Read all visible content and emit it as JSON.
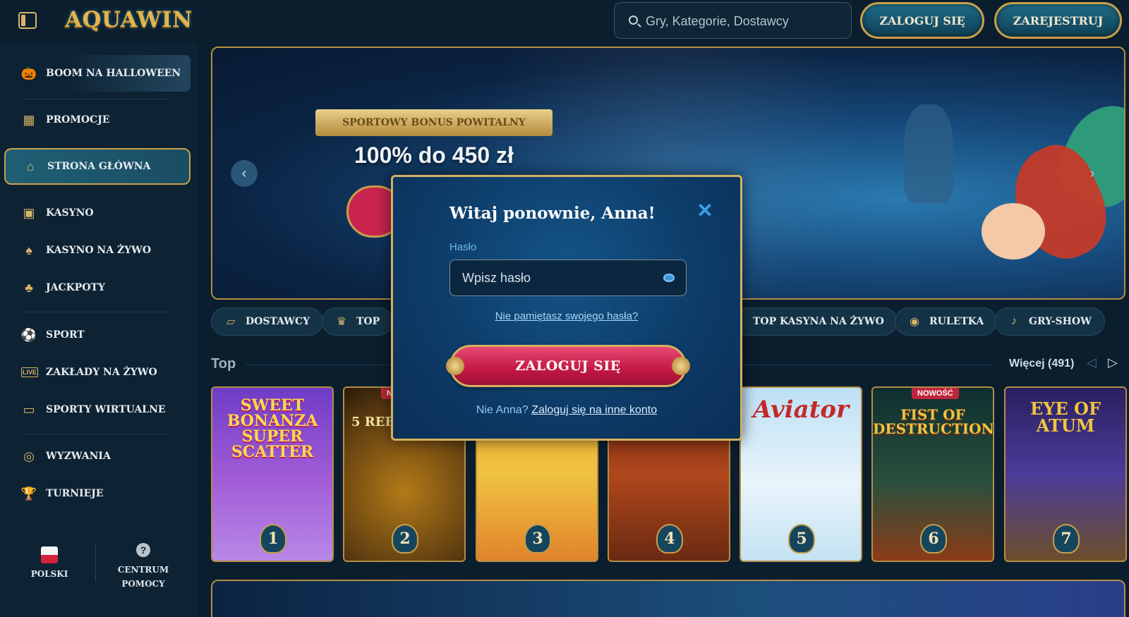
{
  "header": {
    "logo": "AQUAWIN",
    "search_placeholder": "Gry, Kategorie, Dostawcy",
    "login_label": "ZALOGUJ SIĘ",
    "register_label": "ZAREJESTRUJ"
  },
  "sidebar": {
    "items": [
      {
        "label": "BOOM NA HALLOWEEN",
        "icon": "pumpkin-icon"
      },
      {
        "label": "PROMOCJE",
        "icon": "gift-icon"
      },
      {
        "label": "STRONA GŁÓWNA",
        "icon": "home-icon"
      },
      {
        "label": "KASYNO",
        "icon": "slot-machine-icon"
      },
      {
        "label": "KASYNO NA ŻYWO",
        "icon": "live-card-icon"
      },
      {
        "label": "JACKPOTY",
        "icon": "clover-icon"
      },
      {
        "label": "SPORT",
        "icon": "ball-icon"
      },
      {
        "label": "ZAKŁADY NA ŻYWO",
        "icon": "live-badge-icon"
      },
      {
        "label": "SPORTY WIRTUALNE",
        "icon": "virtual-sport-icon"
      },
      {
        "label": "WYZWANIA",
        "icon": "target-icon"
      },
      {
        "label": "TURNIEJE",
        "icon": "trophy-icon"
      }
    ],
    "language": "POLSKI",
    "help": "CENTRUM POMOCY"
  },
  "banner": {
    "ribbon": "SPORTOWY BONUS POWITALNY",
    "headline": "100% do 450 zł"
  },
  "categories": [
    {
      "label": "DOSTAWCY",
      "icon": "scroll-icon"
    },
    {
      "label": "TOP",
      "icon": "crown-icon"
    },
    {
      "label": "TOP KASYNA NA ŻYWO",
      "icon": "live-chip-icon"
    },
    {
      "label": "RULETKA",
      "icon": "roulette-icon"
    },
    {
      "label": "GRY-SHOW",
      "icon": "mic-icon"
    }
  ],
  "top_section": {
    "title": "Top",
    "more": "Więcej (491)",
    "games": [
      {
        "title": "SWEET BONANZA SUPER SCATTER",
        "rank": "1",
        "badge": ""
      },
      {
        "title": "5 REELS",
        "rank": "2",
        "badge": "N"
      },
      {
        "title": "",
        "rank": "3",
        "badge": ""
      },
      {
        "title": "",
        "rank": "4",
        "badge": ""
      },
      {
        "title": "Aviator",
        "rank": "5",
        "badge": ""
      },
      {
        "title": "FIST OF DESTRUCTION",
        "rank": "6",
        "badge": "NOWOŚĆ"
      },
      {
        "title": "EYE OF ATUM",
        "rank": "7",
        "badge": ""
      }
    ]
  },
  "modal": {
    "title": "Witaj ponownie, Anna!",
    "password_label": "Hasło",
    "password_placeholder": "Wpisz hasło",
    "forgot": "Nie pamiętasz swojego hasła?",
    "submit": "ZALOGUJ SIĘ",
    "switch_prefix": "Nie Anna?",
    "switch_link": "Zaloguj się na inne konto"
  },
  "colors": {
    "gold": "#c9a04a",
    "accent_blue": "#39a3e6",
    "cta_red": "#c21843"
  }
}
